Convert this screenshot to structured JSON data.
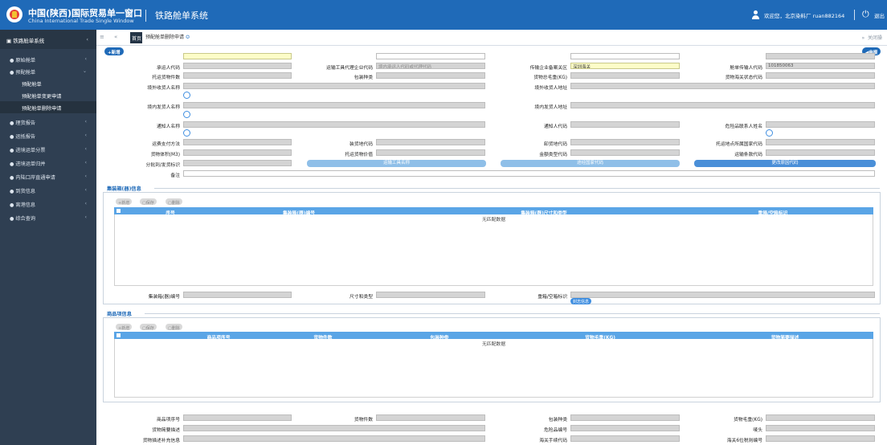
{
  "header": {
    "logo_title": "中国(陕西)国际贸易单一窗口",
    "logo_subtitle": "China International Trade Single Window",
    "system_title": "铁路舱单系统",
    "welcome_text": "欢迎您，北京染料厂 ruan882164",
    "logout_label": "退出"
  },
  "sidebar": {
    "top_label": "铁路舱单系统",
    "items": [
      {
        "label": "原始舱单",
        "arrow": "‹"
      },
      {
        "label": "预配舱单",
        "arrow": "⌄"
      },
      {
        "label": "预配舱单",
        "arrow": ""
      },
      {
        "label": "预配舱单变更申请",
        "arrow": ""
      },
      {
        "label": "预配舱单删除申请",
        "arrow": ""
      },
      {
        "label": "理货报告",
        "arrow": "‹"
      },
      {
        "label": "运抵报告",
        "arrow": "‹"
      },
      {
        "label": "进境运单分票",
        "arrow": "‹"
      },
      {
        "label": "进境运单归并",
        "arrow": "‹"
      },
      {
        "label": "内陆口岸直通申请",
        "arrow": "‹"
      },
      {
        "label": "到货信息",
        "arrow": "‹"
      },
      {
        "label": "离港信息",
        "arrow": "‹"
      },
      {
        "label": "综合查询",
        "arrow": "‹"
      }
    ]
  },
  "tabs": {
    "menu_icon": "≡",
    "back_icon": "«",
    "home_label": "首页",
    "active_label": "预配舱单删除申请",
    "forward_icon": "»",
    "close_ops_label": "关闭操"
  },
  "buttons": {
    "add_new": "+新增",
    "declare": "◀申报"
  },
  "form": {
    "row0": {
      "l1": "境外发货人代码",
      "l2": "承运人代码",
      "l2v": "",
      "l3": "运输工具代理企业代码",
      "l3v": "境内承运人代码或代理代码",
      "l4": "传输企业备案关区",
      "l4v": "深圳海关",
      "l5": "舱单传输人代码",
      "l5v": "101850063"
    },
    "row1": {
      "l1": "托运货物件数",
      "l2": "包装种类",
      "l3": "货物总毛重(KG)",
      "l4": "货物海关状态代码"
    },
    "row2": {
      "l1": "境外收货人名称",
      "l2": "境外收货人地址"
    },
    "row3": {
      "l1": "境内发货人名称",
      "l2": "境内发货人地址"
    },
    "row4": {
      "l1": "通知人名称",
      "l2": "通知人代码",
      "l3": "危险品联系人姓名"
    },
    "row5": {
      "l1": "运费支付方法",
      "l2": "装货地代码",
      "l3": "卸货地代码",
      "l4": "托运地点所属国家代码"
    },
    "row6": {
      "l1": "货物体积(M3)",
      "l2": "托运货物价值",
      "l3": "金额类型代码",
      "l4": "运输条款代码"
    },
    "row7": {
      "l1": "分批到/发货标识",
      "b1": "运输工具名称",
      "b2": "途经国家代码",
      "b3": "更改原因代码"
    },
    "row8": {
      "l1": "备注"
    }
  },
  "container_section": {
    "title": "集装箱(器)信息",
    "btn_add": "新增",
    "btn_save": "保存",
    "btn_delete": "删除",
    "columns": [
      "序号",
      "集装箱(器)编号",
      "集装箱(器)尺寸和类型",
      "重箱/空箱标识"
    ],
    "empty_text": "无匹配数据",
    "f1": "集装箱(器)编号",
    "f2": "尺寸和类型",
    "f3": "重箱/空箱标识",
    "seal_btn": "封志信息"
  },
  "goods_section": {
    "title": "商品项信息",
    "btn_add": "新增",
    "btn_save": "保存",
    "btn_delete": "删除",
    "columns": [
      "商品项序号",
      "货物件数",
      "包装种类",
      "货物毛重(KG)",
      "货物简要描述"
    ],
    "empty_text": "无匹配数据",
    "f_row1": [
      "商品项序号",
      "货物件数",
      "包装种类",
      "货物毛重(KG)"
    ],
    "f_row2": [
      "货物简要描述",
      "危险品编号",
      "唛头"
    ],
    "f_row3": [
      "货物描述补充信息",
      "海关手续代码",
      "海关6位税则编号"
    ]
  },
  "colors": {
    "header_bg": "#1f6ab8",
    "sidebar_bg": "#2f3f52",
    "table_head": "#5aa5e6",
    "highlight_field": "#fdfdc8"
  }
}
